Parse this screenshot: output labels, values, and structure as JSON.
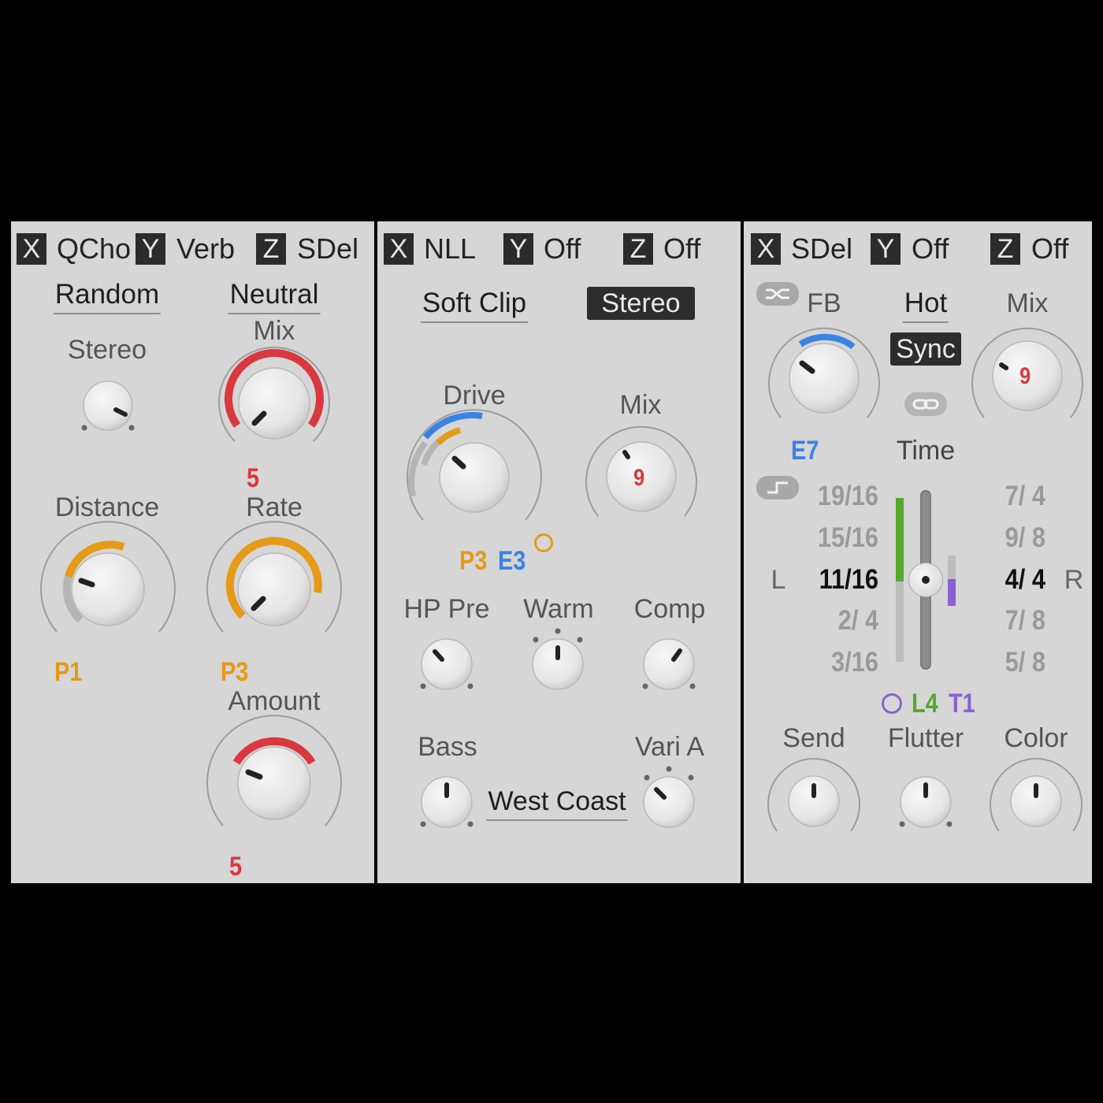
{
  "colors": {
    "panel_bg": "#d6d6d6",
    "red": "#d9383f",
    "orange": "#e59a18",
    "blue": "#3b82e6",
    "green": "#54a82c",
    "purple": "#8a60d0"
  },
  "panel1": {
    "xyz": [
      {
        "letter": "X",
        "value": "QCho"
      },
      {
        "letter": "Y",
        "value": "Verb"
      },
      {
        "letter": "Z",
        "value": "SDel"
      }
    ],
    "mode_left": "Random",
    "mode_right": "Neutral",
    "stereo_label": "Stereo",
    "mix_label": "Mix",
    "mix_value": "5",
    "distance_label": "Distance",
    "distance_tag": "P1",
    "rate_label": "Rate",
    "rate_tag": "P3",
    "amount_label": "Amount",
    "amount_value": "5"
  },
  "panel2": {
    "xyz": [
      {
        "letter": "X",
        "value": "NLL"
      },
      {
        "letter": "Y",
        "value": "Off"
      },
      {
        "letter": "Z",
        "value": "Off"
      }
    ],
    "clip_mode": "Soft Clip",
    "stereo_button": "Stereo",
    "drive_label": "Drive",
    "drive_tag_p": "P3",
    "drive_tag_e": "E3",
    "mix_label": "Mix",
    "mix_value": "9",
    "hp_pre_label": "HP Pre",
    "warm_label": "Warm",
    "comp_label": "Comp",
    "bass_label": "Bass",
    "vari_label": "Vari A",
    "voicing": "West Coast"
  },
  "panel3": {
    "xyz": [
      {
        "letter": "X",
        "value": "SDel"
      },
      {
        "letter": "Y",
        "value": "Off"
      },
      {
        "letter": "Z",
        "value": "Off"
      }
    ],
    "fb_label": "FB",
    "fb_tag": "E7",
    "hot_label": "Hot",
    "sync_button": "Sync",
    "mix_label": "Mix",
    "mix_value": "9",
    "time_label": "Time",
    "left_label": "L",
    "right_label": "R",
    "left_divisions": [
      "19/16",
      "15/16",
      "11/16",
      "2/ 4",
      "3/16"
    ],
    "right_divisions": [
      "7/ 4",
      "9/ 8",
      "4/ 4",
      "7/ 8",
      "5/ 8"
    ],
    "selected_index": 2,
    "lfo_tag": "L4",
    "t_tag": "T1",
    "send_label": "Send",
    "flutter_label": "Flutter",
    "color_label": "Color"
  }
}
